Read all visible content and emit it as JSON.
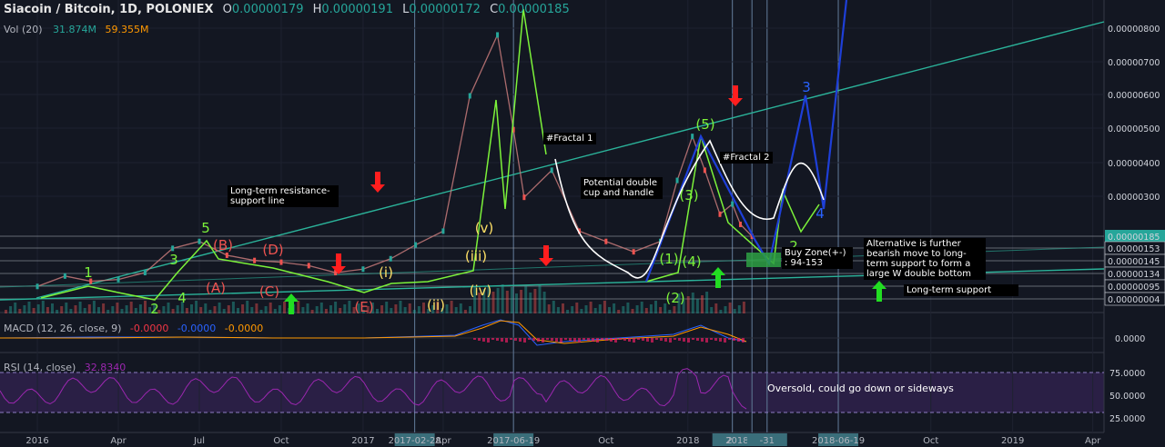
{
  "header": {
    "symbol": "Siacoin / Bitcoin, 1D, POLONIEX",
    "o_key": "O",
    "o_val": "0.00000179",
    "h_key": "H",
    "h_val": "0.00000191",
    "l_key": "L",
    "l_val": "0.00000172",
    "c_key": "C",
    "c_val": "0.00000185"
  },
  "volume": {
    "label": "Vol (20)",
    "v1": "31.874M",
    "v2": "59.355M"
  },
  "macd": {
    "label": "MACD (12, 26, close, 9)",
    "v1": "-0.0000",
    "v2": "-0.0000",
    "v3": "-0.0000",
    "axis": "0.0000"
  },
  "rsi": {
    "label": "RSI (14, close)",
    "v1": "32.8340",
    "ticks": [
      "75.0000",
      "50.0000",
      "25.0000"
    ]
  },
  "colors": {
    "bg": "#131722",
    "up": "#26a69a",
    "down": "#ef5350",
    "wave_green": "#7cf23a",
    "wave_blue": "#1e3fd8",
    "trend": "#2bb39a",
    "rsi": "#9c27b0"
  },
  "annotations": {
    "resistance": "Long-term resistance-\nsupport line",
    "fractal1": "#Fractal 1",
    "fractal2": "#Fractal 2",
    "cup": "Potential double\ncup and handle",
    "buyzone": "Buy Zone(+-)\n: 94-153",
    "alternative": "Alternative is further\nbearish move to long-\nterm support to form a\nlarge W double bottom",
    "longterm": "Long-term support",
    "oversold": "Oversold, could go down or sideways"
  },
  "chart_data": {
    "type": "line",
    "title": "Siacoin / Bitcoin, 1D, POLONIEX",
    "x_ticks": [
      "2016",
      "Apr",
      "Jul",
      "Oct",
      "2017",
      "2017-02-28",
      "Apr",
      "2017-06-19",
      "Oct",
      "2018",
      "20",
      "2018-03-14",
      "-31",
      "2018-06-19",
      "Oct",
      "2019",
      "Apr"
    ],
    "y_ticks": [
      "0.00000800",
      "0.00000700",
      "0.00000600",
      "0.00000500",
      "0.00000400",
      "0.00000300",
      "0.00000185",
      "0.00000153",
      "0.00000145",
      "0.00000134",
      "0.00000095",
      "0.00000004"
    ],
    "last_price": "0.00000185",
    "series": [
      {
        "values": [
          [
            "2016-01-01",
            4e-07
          ],
          [
            "2016-02-01",
            7e-07
          ],
          [
            "2016-03-01",
            5.5e-07
          ],
          [
            "2016-04-01",
            6e-07
          ],
          [
            "2016-05-01",
            8e-07
          ],
          [
            "2016-06-01",
            1.5e-06
          ],
          [
            "2016-07-01",
            1.7e-06
          ],
          [
            "2016-08-01",
            1.3e-06
          ],
          [
            "2016-09-01",
            1.15e-06
          ],
          [
            "2016-10-01",
            1.1e-06
          ],
          [
            "2016-11-01",
            1e-06
          ],
          [
            "2016-12-01",
            8e-07
          ],
          [
            "2017-01-01",
            9e-07
          ],
          [
            "2017-02-01",
            1.2e-06
          ],
          [
            "2017-03-01",
            1.6e-06
          ],
          [
            "2017-04-01",
            2e-06
          ],
          [
            "2017-05-01",
            6e-06
          ],
          [
            "2017-06-01",
            7.8e-06
          ],
          [
            "2017-06-19",
            5e-06
          ],
          [
            "2017-07-01",
            3e-06
          ],
          [
            "2017-08-01",
            3.8e-06
          ],
          [
            "2017-09-01",
            2e-06
          ],
          [
            "2017-10-01",
            1.7e-06
          ],
          [
            "2017-11-01",
            1.4e-06
          ],
          [
            "2017-12-01",
            1.7e-06
          ],
          [
            "2017-12-20",
            3.5e-06
          ],
          [
            "2018-01-06",
            4.8e-06
          ],
          [
            "2018-01-20",
            3.8e-06
          ],
          [
            "2018-02-06",
            2.5e-06
          ],
          [
            "2018-02-20",
            2.8e-06
          ],
          [
            "2018-03-01",
            2.2e-06
          ],
          [
            "2018-03-14",
            1.85e-06
          ]
        ]
      }
    ],
    "wave_labels": [
      "1",
      "2",
      "3",
      "4",
      "5",
      "(A)",
      "(B)",
      "(C)",
      "(D)",
      "(E)",
      "(i)",
      "(ii)",
      "(iii)",
      "(iv)",
      "(v)",
      "(1)",
      "(2)",
      "(3)",
      "(4)",
      "(5)",
      "3",
      "4",
      "2"
    ],
    "grid": true,
    "ylim": [
      4e-08,
      8.5e-06
    ]
  }
}
